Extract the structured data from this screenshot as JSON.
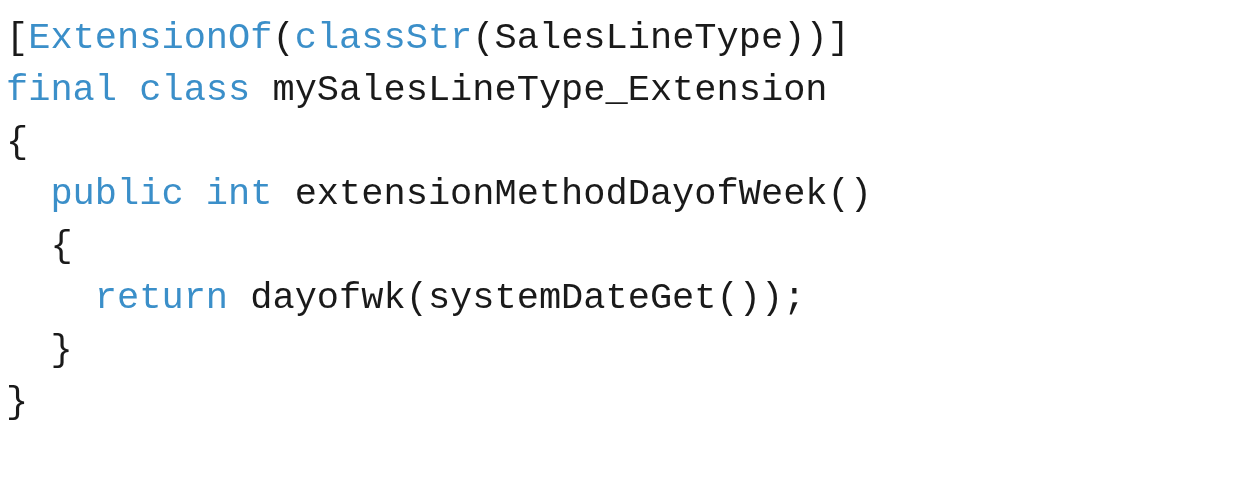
{
  "code_lines": [
    {
      "tokens": [
        {
          "kind": "plain",
          "text": "["
        },
        {
          "kind": "keyword",
          "text": "ExtensionOf"
        },
        {
          "kind": "plain",
          "text": "("
        },
        {
          "kind": "keyword",
          "text": "classStr"
        },
        {
          "kind": "plain",
          "text": "(SalesLineType))]"
        }
      ]
    },
    {
      "tokens": [
        {
          "kind": "keyword",
          "text": "final class"
        },
        {
          "kind": "plain",
          "text": " mySalesLineType_Extension"
        }
      ]
    },
    {
      "tokens": [
        {
          "kind": "plain",
          "text": "{"
        }
      ]
    },
    {
      "tokens": [
        {
          "kind": "keyword",
          "text": "  public int"
        },
        {
          "kind": "plain",
          "text": " extensionMethodDayofWeek()"
        }
      ]
    },
    {
      "tokens": [
        {
          "kind": "plain",
          "text": "  {"
        }
      ]
    },
    {
      "tokens": [
        {
          "kind": "keyword",
          "text": "    return"
        },
        {
          "kind": "plain",
          "text": " dayofwk(systemDateGet());"
        }
      ]
    },
    {
      "tokens": [
        {
          "kind": "plain",
          "text": "  }"
        }
      ]
    },
    {
      "tokens": [
        {
          "kind": "plain",
          "text": "}"
        }
      ]
    }
  ]
}
